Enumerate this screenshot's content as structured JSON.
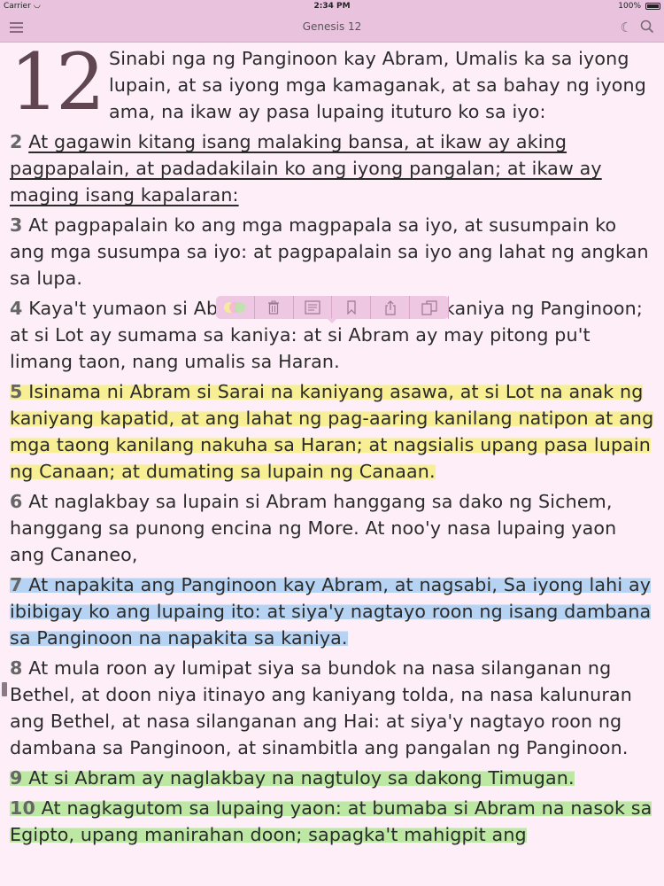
{
  "status_bar": {
    "carrier": "Carrier",
    "time": "2:34 PM",
    "battery": "100%"
  },
  "nav": {
    "title": "Genesis 12",
    "left_icon": "hamburger-menu-icon",
    "right_icons": [
      "night-mode-icon",
      "search-icon"
    ]
  },
  "chapter": {
    "number": "12",
    "verse1": "Sinabi nga ng Panginoon kay Abram, Umalis ka sa iyong lupain, at sa iyong mga kamaganak, at sa bahay ng iyong ama, na ikaw ay pasa lupaing ituturo ko sa iyo:",
    "verses": [
      {
        "num": "2",
        "text": "At gagawin kitang isang malaking bansa, at ikaw ay aking pagpapalain, at padadakilain ko ang iyong pangalan; at ikaw ay maging isang kapalaran:",
        "style": "underline"
      },
      {
        "num": "3",
        "text": "At pagpapalain ko ang mga magpapala sa iyo, at susumpain ko ang mga susumpa sa iyo: at pagpapalain sa iyo ang lahat ng angkan sa lupa.",
        "style": "none"
      },
      {
        "num": "4",
        "text": "Kaya't yumaon si Abram, ayon sa sinalita sa kaniya ng Panginoon; at si Lot ay sumama sa kaniya: at si Abram ay may pitong pu't limang taon, nang umalis sa Haran.",
        "style": "none"
      },
      {
        "num": "5",
        "text": "Isinama ni Abram si Sarai na kaniyang asawa, at si Lot na anak ng kaniyang kapatid, at ang lahat ng pag-aaring kanilang natipon at ang mga taong kanilang nakuha sa Haran; at nagsialis upang pasa lupain ng Canaan; at dumating sa lupain ng Canaan.",
        "style": "yellow"
      },
      {
        "num": "6",
        "text": "At naglakbay sa lupain si Abram hanggang sa dako ng Sichem, hanggang sa punong encina ng More. At noo'y nasa lupaing yaon ang Cananeo,",
        "style": "none"
      },
      {
        "num": "7",
        "text": "At napakita ang Panginoon kay Abram, at nagsabi, Sa iyong lahi ay ibibigay ko ang lupaing ito: at siya'y nagtayo roon ng isang dambana sa Panginoon na napakita sa kaniya.",
        "style": "blue"
      },
      {
        "num": "8",
        "text": "At mula roon ay lumipat siya sa bundok na nasa silanganan ng Bethel, at doon niya itinayo ang kaniyang tolda, na nasa kalunuran ang Bethel, at nasa silanganan ang Hai: at siya'y nagtayo roon ng dambana sa Panginoon, at sinambitla ang pangalan ng Panginoon.",
        "style": "none"
      },
      {
        "num": "9",
        "text": "At si Abram ay naglakbay na nagtuloy sa dakong Timugan.",
        "style": "green"
      },
      {
        "num": "10",
        "text": "At nagkagutom sa lupaing yaon: at bumaba si Abram na nasok sa Egipto, upang manirahan doon; sapagka't mahigpit ang",
        "style": "green"
      }
    ]
  },
  "toolbar": {
    "tools": [
      "highlight-color-icon",
      "trash-icon",
      "note-icon",
      "bookmark-icon",
      "share-icon",
      "copy-icon"
    ],
    "highlight_colors": [
      "#f8ee93",
      "#f5b6d8",
      "#b7e6a4"
    ]
  },
  "colors": {
    "background": "#fdeef7",
    "bar": "#e9c3de",
    "yellow": "#f8ee93",
    "blue": "#b7d3f4",
    "green": "#bde8a4"
  }
}
